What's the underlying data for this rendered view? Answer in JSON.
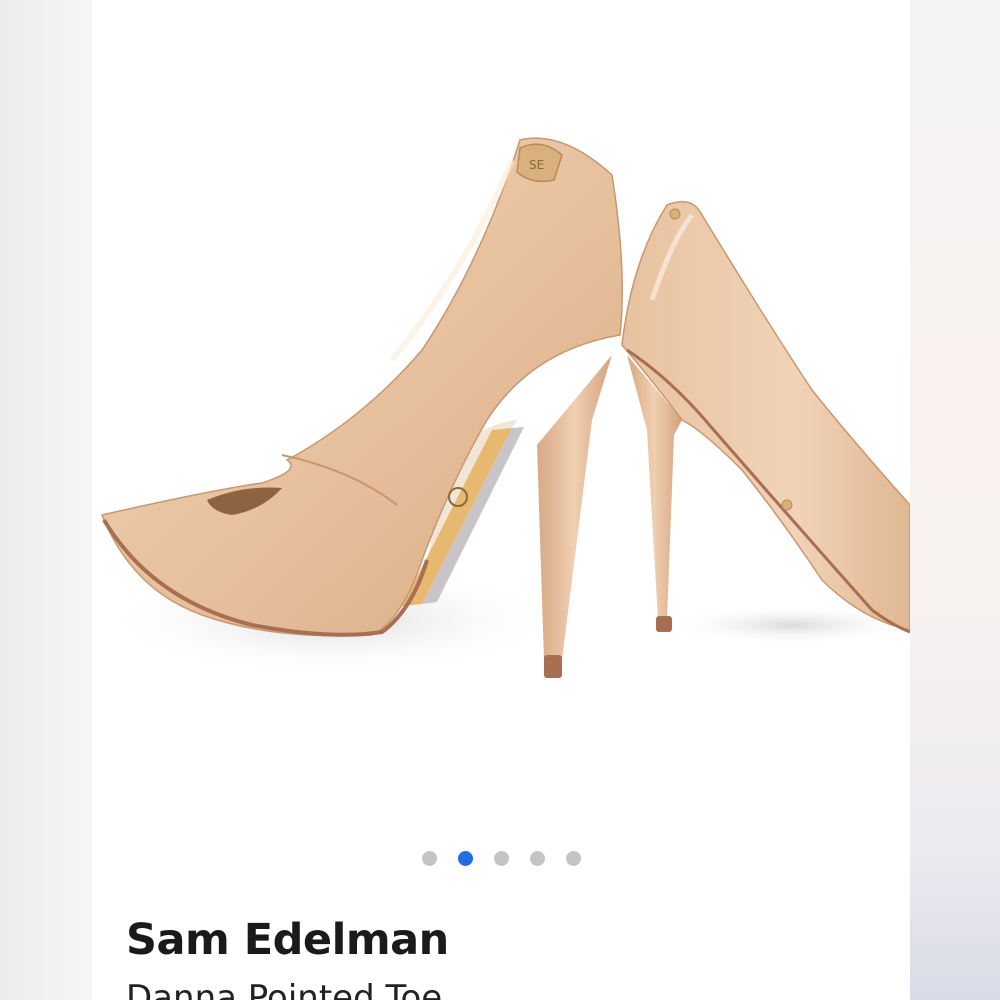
{
  "product": {
    "brand": "Sam Edelman",
    "name": "Danna Pointed Toe",
    "image_alt": "Sam Edelman nude patent pointed toe pumps"
  },
  "carousel": {
    "total": 5,
    "active_index": 1
  },
  "colors": {
    "active_dot": "#1f6fe0",
    "inactive_dot": "#c4c4c4",
    "shoe": "#e9c3a1"
  },
  "icons": {
    "logo_charm": "se-logo-icon"
  }
}
